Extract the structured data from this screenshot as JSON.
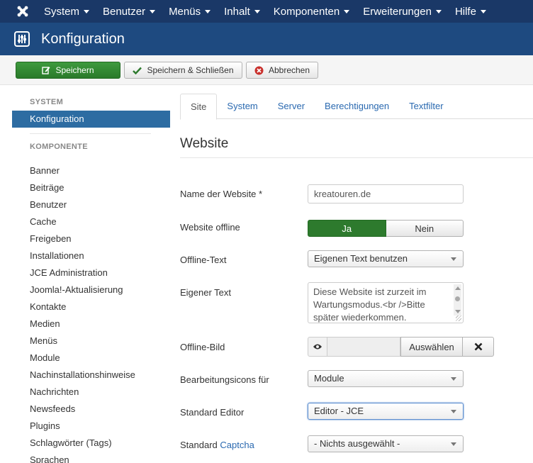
{
  "topnav": {
    "items": [
      {
        "label": "System"
      },
      {
        "label": "Benutzer"
      },
      {
        "label": "Menüs"
      },
      {
        "label": "Inhalt"
      },
      {
        "label": "Komponenten"
      },
      {
        "label": "Erweiterungen"
      },
      {
        "label": "Hilfe"
      }
    ]
  },
  "header": {
    "title": "Konfiguration",
    "icon": "equalizer-icon"
  },
  "toolbar": {
    "save_label": "Speichern",
    "save_close_label": "Speichern & Schließen",
    "cancel_label": "Abbrechen"
  },
  "sidebar": {
    "system_header": "SYSTEM",
    "system_item": "Konfiguration",
    "component_header": "KOMPONENTE",
    "items": [
      "Banner",
      "Beiträge",
      "Benutzer",
      "Cache",
      "Freigeben",
      "Installationen",
      "JCE Administration",
      "Joomla!-Aktualisierung",
      "Kontakte",
      "Medien",
      "Menüs",
      "Module",
      "Nachinstallationshinweise",
      "Nachrichten",
      "Newsfeeds",
      "Plugins",
      "Schlagwörter (Tags)",
      "Sprachen"
    ]
  },
  "tabs": [
    "Site",
    "System",
    "Server",
    "Berechtigungen",
    "Textfilter"
  ],
  "form": {
    "section_title": "Website",
    "sitename_label": "Name der Website *",
    "sitename_value": "kreatouren.de",
    "offline_label": "Website offline",
    "offline_yes": "Ja",
    "offline_no": "Nein",
    "offline_text_label": "Offline-Text",
    "offline_text_value": "Eigenen Text benutzen",
    "custom_text_label": "Eigener Text",
    "custom_text_value": "Diese Website ist zurzeit im Wartungsmodus.<br />Bitte später wiederkommen.",
    "offline_image_label": "Offline-Bild",
    "choose_label": "Auswählen",
    "frontend_edit_label": "Bearbeitungsicons für",
    "frontend_edit_value": "Module",
    "editor_label": "Standard Editor",
    "editor_value": "Editor - JCE",
    "captcha_label_prefix": "Standard ",
    "captcha_label_link": "Captcha",
    "captcha_value": "- Nichts ausgewählt -"
  },
  "colors": {
    "nav_bg": "#1a3867",
    "header_bg": "#1e4a80",
    "save_green": "#2d7a2d",
    "active_blue": "#2d6ca2"
  }
}
